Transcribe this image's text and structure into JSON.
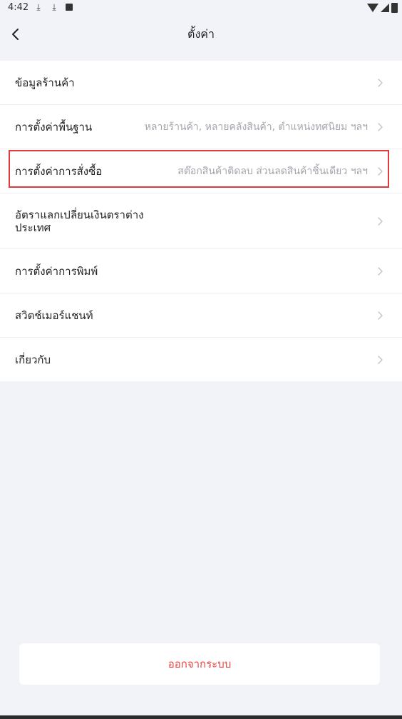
{
  "status_bar": {
    "time": "4:42",
    "left_icons": [
      "download-icon",
      "download-icon",
      "app-notification-icon"
    ],
    "right_icons": [
      "wifi-icon",
      "signal-icon",
      "battery-icon"
    ]
  },
  "header": {
    "title": "ตั้งค่า",
    "back_icon": "chevron-left-icon"
  },
  "settings_items": [
    {
      "label": "ข้อมูลร้านค้า",
      "value": ""
    },
    {
      "label": "การตั้งค่าพื้นฐาน",
      "value": "หลายร้านค้า, หลายคลังสินค้า, ตำแหน่งทศนิยม ฯลฯ"
    },
    {
      "label": "การตั้งค่าการสั่งซื้อ",
      "value": "สต๊อกสินค้าติดลบ ส่วนลดสินค้าชิ้นเดียว ฯลฯ"
    },
    {
      "label": "อัตราแลกเปลี่ยนเงินตราต่างประเทศ",
      "value": ""
    },
    {
      "label": "การตั้งค่าการพิมพ์",
      "value": ""
    },
    {
      "label": "สวิตช์เมอร์แชนท์",
      "value": ""
    },
    {
      "label": "เกี่ยวกับ",
      "value": ""
    }
  ],
  "highlighted_item": "การตั้งค่าการสั่งซื้อ",
  "logout_label": "ออกจากระบบ",
  "colors": {
    "background": "#f1f3f8",
    "highlight_border": "#e03a3e",
    "logout_text": "#e8453c",
    "secondary_text": "#a3a6ad"
  }
}
